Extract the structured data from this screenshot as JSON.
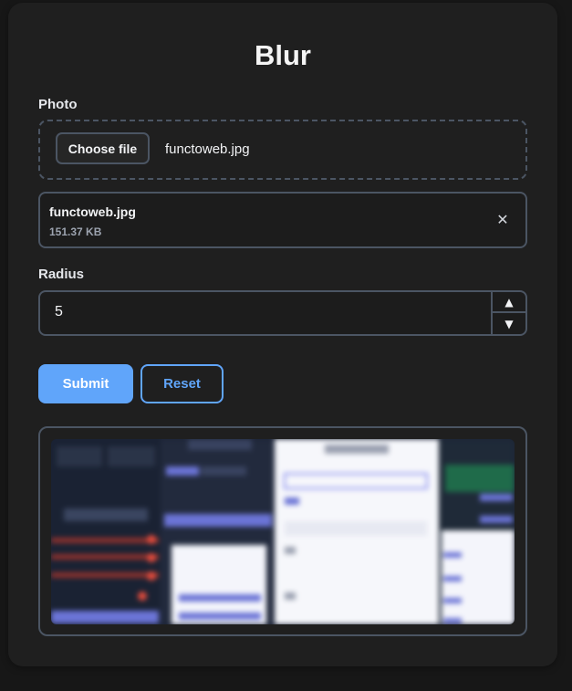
{
  "app": {
    "title": "Blur"
  },
  "photo": {
    "label": "Photo",
    "choose_button": "Choose file",
    "chosen_name": "functoweb.jpg"
  },
  "file": {
    "name": "functoweb.jpg",
    "size": "151.37 KB",
    "remove_icon": "close-icon"
  },
  "radius": {
    "label": "Radius",
    "value": "5",
    "up_icon": "▲",
    "down_icon": "▼"
  },
  "actions": {
    "submit_label": "Submit",
    "reset_label": "Reset"
  },
  "preview": {
    "image_alt": "blurred-preview"
  },
  "colors": {
    "accent": "#60a5fa",
    "background": "#171717",
    "card": "#1f1f1f",
    "border": "#4b5563"
  }
}
